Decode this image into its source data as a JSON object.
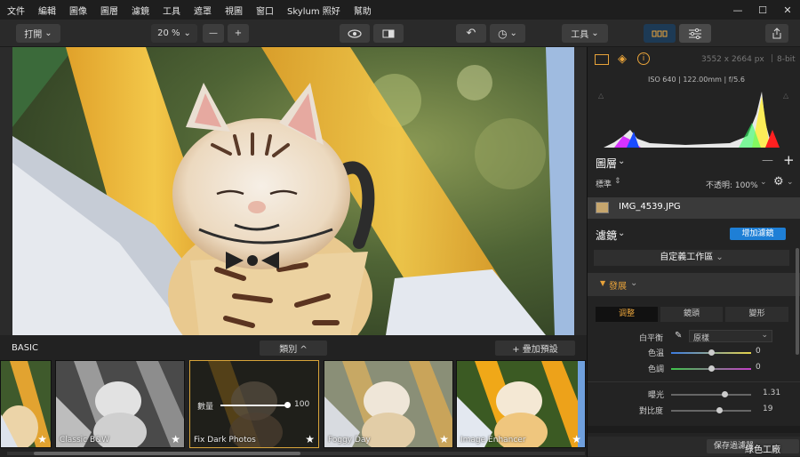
{
  "menu": [
    "文件",
    "編輯",
    "圖像",
    "圖層",
    "濾鏡",
    "工具",
    "遮罩",
    "視圖",
    "窗口",
    "Skylum 照好",
    "幫助"
  ],
  "window_controls": [
    "—",
    "☐",
    "✕"
  ],
  "toolbar": {
    "open_label": "打開",
    "zoom_value": "20 %",
    "zoom_out": "—",
    "zoom_in": "+",
    "tools_label": "工具"
  },
  "bottom": {
    "section": "BASIC",
    "category": "類別 ^",
    "add_preset": "+ 疊加預設",
    "amount_label": "數量",
    "amount_value": "100",
    "amount_level": 1.0,
    "thumbs": [
      {
        "label": ""
      },
      {
        "label": "Classic B&W"
      },
      {
        "label": "Fix Dark Photos",
        "selected": true
      },
      {
        "label": "Foggy Day"
      },
      {
        "label": "Image Enhancer"
      }
    ]
  },
  "side": {
    "dimensions": "3552 x 2664 px",
    "bitdepth": "8-bit",
    "exif": "ISO 640  |  122.00mm  |  f/5.6",
    "layers_title": "圖層",
    "blend_mode": "標準",
    "opacity": "不透明: 100%",
    "filename": "IMG_4539.JPG",
    "filters_title": "濾鏡",
    "add_filter": "增加濾鏡",
    "workspace": "自定義工作區",
    "develop": "發展",
    "tabs": [
      "调整",
      "鏡頭",
      "變形"
    ],
    "white_balance_label": "白平衡",
    "white_balance_value": "原樣",
    "temp_label": "色溫",
    "temp_value": "0",
    "tint_label": "色調",
    "tint_value": "0",
    "exposure_label": "曝光",
    "exposure_value": "1.31",
    "contrast_label": "對比度",
    "contrast_value": "19",
    "save_label": "保存過濾器"
  },
  "watermark": "綠色工廠",
  "colors": {
    "accent": "#1e7fd6",
    "selected_border": "#d8a43a"
  }
}
